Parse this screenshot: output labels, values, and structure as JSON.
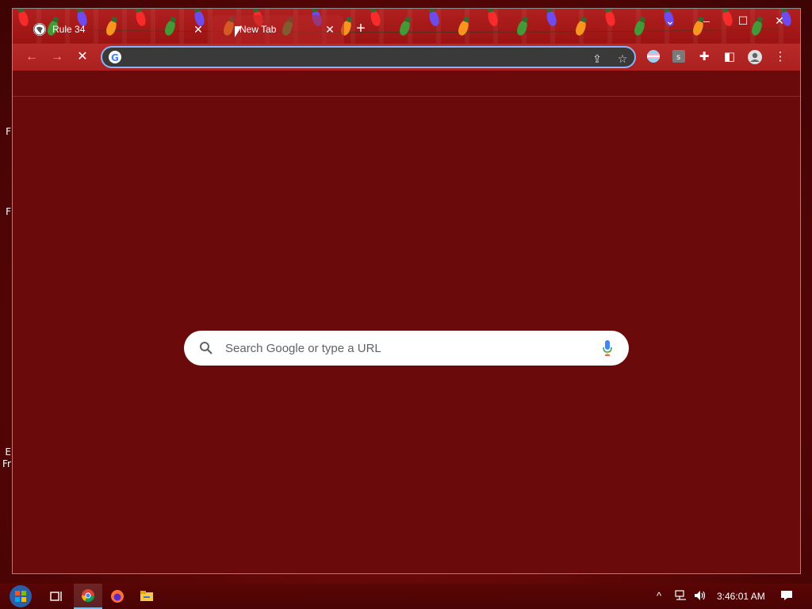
{
  "browser": {
    "tabs": [
      {
        "title": "Rule 34",
        "active": false
      },
      {
        "title": "New Tab",
        "active": true
      }
    ],
    "new_tab_symbol": "+",
    "window_controls": {
      "tab_search": "⌄",
      "minimize": "–",
      "maximize": "☐",
      "close": "✕"
    },
    "toolbar": {
      "back": "←",
      "forward": "→",
      "stop": "✕",
      "omnibox_value": "",
      "share": "⇪",
      "bookmark": "☆",
      "extensions": "✚",
      "side_panel": "◧",
      "profile": "●",
      "menu": "⋮"
    },
    "ntp": {
      "search_placeholder": "Search Google or type a URL"
    }
  },
  "desktop": {
    "edge_fragments": [
      "F",
      "F",
      "E",
      "Fr"
    ]
  },
  "taskbar": {
    "clock": "3:46:01 AM",
    "tray_chevron": "^"
  },
  "colors": {
    "window_bg": "#6a0a0a",
    "tab_strip": "#b0201f",
    "omnibox_border": "#8ab4f8"
  }
}
